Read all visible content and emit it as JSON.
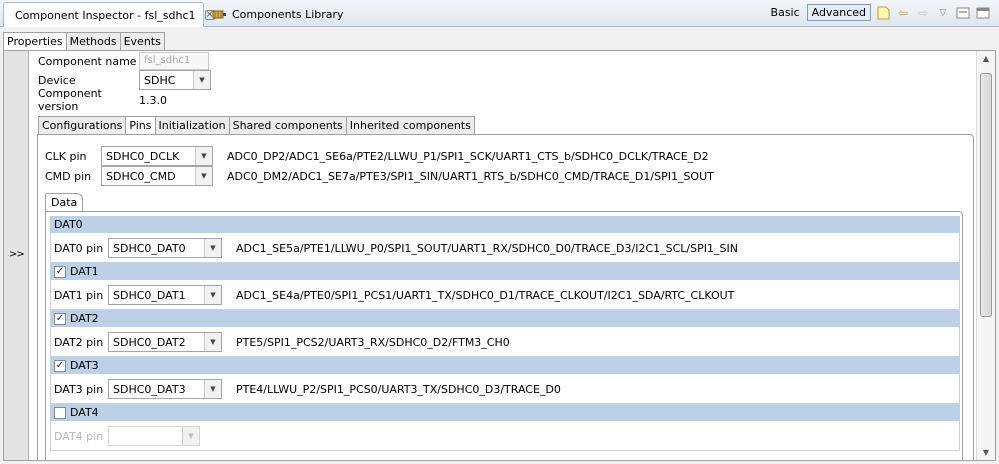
{
  "view_tabs": {
    "inspector": "Component Inspector - fsl_sdhc1",
    "library": "Components Library",
    "basic": "Basic",
    "advanced": "Advanced"
  },
  "prop_tabs": [
    "Properties",
    "Methods",
    "Events"
  ],
  "expand_label": ">>",
  "fields": {
    "component_name_label": "Component name",
    "component_name_value": "fsl_sdhc1",
    "device_label": "Device",
    "device_value": "SDHC",
    "version_label": "Component version",
    "version_value": "1.3.0"
  },
  "inner_tabs": [
    "Configurations",
    "Pins",
    "Initialization",
    "Shared components",
    "Inherited components"
  ],
  "pins": [
    {
      "label": "CLK pin",
      "value": "SDHC0_DCLK",
      "func": "ADC0_DP2/ADC1_SE6a/PTE2/LLWU_P1/SPI1_SCK/UART1_CTS_b/SDHC0_DCLK/TRACE_D2"
    },
    {
      "label": "CMD pin",
      "value": "SDHC0_CMD",
      "func": "ADC0_DM2/ADC1_SE7a/PTE3/SPI1_SIN/UART1_RTS_b/SDHC0_CMD/TRACE_D1/SPI1_SOUT"
    }
  ],
  "data_tab": "Data",
  "data_groups": [
    {
      "title": "DAT0",
      "checkbox": false,
      "checked": false,
      "pin_label": "DAT0 pin",
      "value": "SDHC0_DAT0",
      "func": "ADC1_SE5a/PTE1/LLWU_P0/SPI1_SOUT/UART1_RX/SDHC0_D0/TRACE_D3/I2C1_SCL/SPI1_SIN"
    },
    {
      "title": "DAT1",
      "checkbox": true,
      "checked": true,
      "pin_label": "DAT1 pin",
      "value": "SDHC0_DAT1",
      "func": "ADC1_SE4a/PTE0/SPI1_PCS1/UART1_TX/SDHC0_D1/TRACE_CLKOUT/I2C1_SDA/RTC_CLKOUT"
    },
    {
      "title": "DAT2",
      "checkbox": true,
      "checked": true,
      "pin_label": "DAT2 pin",
      "value": "SDHC0_DAT2",
      "func": "PTE5/SPI1_PCS2/UART3_RX/SDHC0_D2/FTM3_CH0"
    },
    {
      "title": "DAT3",
      "checkbox": true,
      "checked": true,
      "pin_label": "DAT3 pin",
      "value": "SDHC0_DAT3",
      "func": "PTE4/LLWU_P2/SPI1_PCS0/UART3_TX/SDHC0_D3/TRACE_D0"
    },
    {
      "title": "DAT4",
      "checkbox": true,
      "checked": false,
      "pin_label": "DAT4 pin",
      "value": "",
      "func": ""
    }
  ]
}
